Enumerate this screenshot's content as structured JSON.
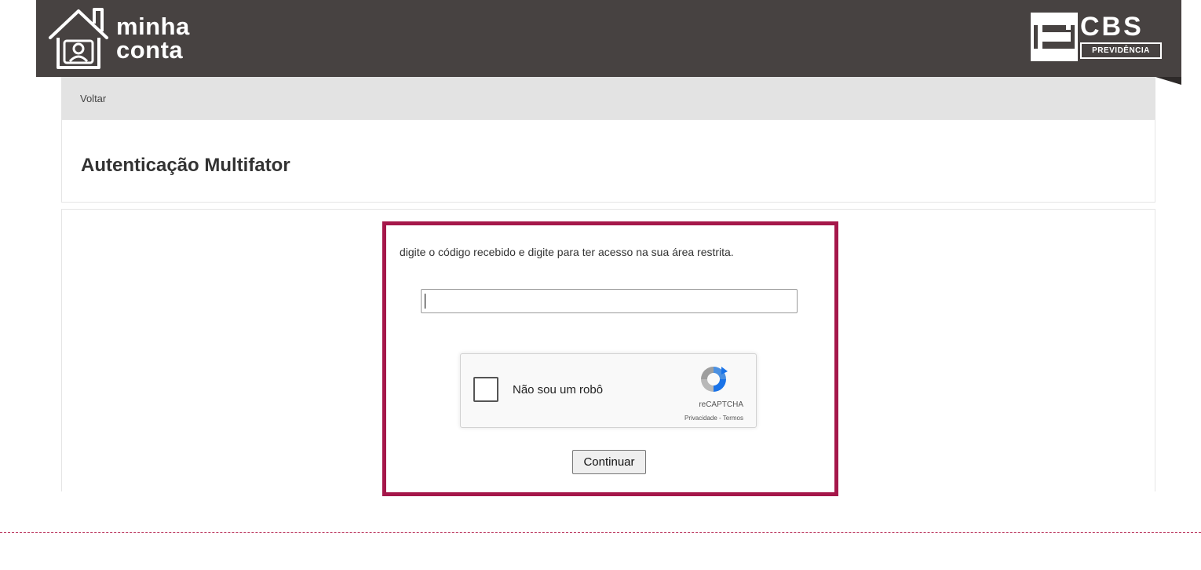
{
  "header": {
    "logo_minha": "minha",
    "logo_conta": "conta",
    "logo_cbs": "CBS",
    "logo_previdencia": "PREVIDÊNCIA"
  },
  "nav": {
    "back_label": "Voltar"
  },
  "page": {
    "title": "Autenticação Multifator"
  },
  "form": {
    "instruction": "digite o código recebido e digite para ter acesso na sua área restrita.",
    "code_value": "",
    "continue_label": "Continuar"
  },
  "recaptcha": {
    "label": "Não sou um robô",
    "brand": "reCAPTCHA",
    "terms": "Privacidade - Termos"
  },
  "colors": {
    "header_bg": "#474241",
    "nav_bg": "#e3e3e3",
    "highlight": "#a5174a"
  }
}
